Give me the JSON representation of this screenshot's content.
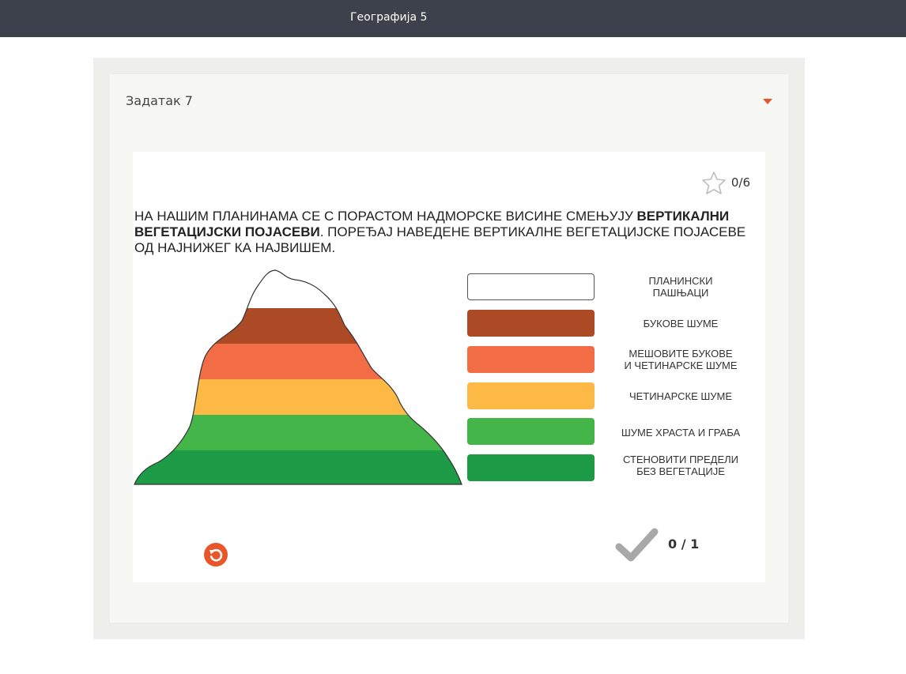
{
  "header": {
    "title": "Географија 5"
  },
  "task": {
    "title": "Задатак 7"
  },
  "score": {
    "value": "0/6"
  },
  "instruction": {
    "part1": "НА НАШИМ ПЛАНИНАМА СЕ С ПОРАСТОМ НАДМОРСКЕ ВИСИНЕ СМЕЊУЈУ ",
    "bold": "ВЕРТИКАЛНИ ВЕГЕТАЦИЈСКИ ПОЈАСЕВИ",
    "part2": ". ПОРЕЂАЈ НАВЕДЕНЕ ВЕРТИКАЛНЕ ВЕГЕТАЦИЈСКЕ ПОЈАСЕВЕ ОД НАЈНИЖЕГ КА НАЈВИШЕМ."
  },
  "colors": {
    "accent": "#e8572a",
    "band_snow": "#ffffff",
    "band_beech": "#ab4a24",
    "band_mixed": "#f26d46",
    "band_conifer": "#fdb945",
    "band_oak": "#44b549",
    "band_rocky": "#1d9b46"
  },
  "items": [
    {
      "line1": "ПЛАНИНСКИ",
      "line2": "ПАШЊАЦИ",
      "color": "#ffffff"
    },
    {
      "line1": "БУКОВЕ ШУМЕ",
      "line2": "",
      "color": "#ab4a24"
    },
    {
      "line1": "МЕШОВИТЕ БУКОВЕ",
      "line2": "И ЧЕТИНАРСКЕ ШУМЕ",
      "color": "#f26d46"
    },
    {
      "line1": "ЧЕТИНАРСКЕ ШУМЕ",
      "line2": "",
      "color": "#fdb945"
    },
    {
      "line1": "ШУМЕ ХРАСТА И ГРАБА",
      "line2": "",
      "color": "#44b549"
    },
    {
      "line1": "СТЕНОВИТИ ПРЕДЕЛИ",
      "line2": "БЕЗ ВЕГЕТАЦИЈЕ",
      "color": "#1d9b46"
    }
  ],
  "check": {
    "score": "0 / 1"
  },
  "icons": {
    "star": "star-icon",
    "reset": "reset-icon",
    "check": "check-icon",
    "dropdown": "chevron-down-icon"
  }
}
